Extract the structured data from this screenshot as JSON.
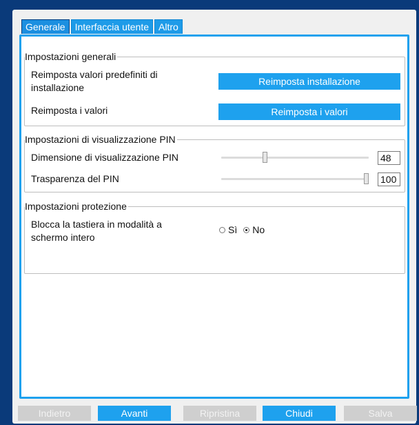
{
  "tabs": [
    {
      "label": "Generale",
      "active": true
    },
    {
      "label": "Interfaccia utente",
      "active": false
    },
    {
      "label": "Altro",
      "active": false
    }
  ],
  "general_settings": {
    "title": "Impostazioni generali",
    "reset_defaults_label": "Reimposta valori predefiniti di installazione",
    "reset_install_button": "Reimposta installazione",
    "reset_values_label": "Reimposta i valori",
    "reset_values_button": "Reimposta i valori"
  },
  "pin_display": {
    "title": "Impostazioni di visualizzazione PIN",
    "size_label": "Dimensione di visualizzazione PIN",
    "size_value": "48",
    "size_fraction": 0.29,
    "transparency_label": "Trasparenza del PIN",
    "transparency_value": "100",
    "transparency_fraction": 1.0
  },
  "protection": {
    "title": "Impostazioni protezione",
    "lock_keyboard_label": "Blocca la tastiera in modalità a schermo intero",
    "option_yes": "Sì",
    "option_no": "No",
    "selected": "No"
  },
  "bottom_buttons": [
    {
      "label": "Indietro",
      "enabled": false
    },
    {
      "label": "Avanti",
      "enabled": true
    },
    {
      "label": "Ripristina",
      "enabled": false
    },
    {
      "label": "Chiudi",
      "enabled": true
    },
    {
      "label": "Salva",
      "enabled": false
    }
  ],
  "colors": {
    "accent": "#1ea1ee",
    "background": "#0a3a7a",
    "disabled": "#cfcfcf"
  }
}
